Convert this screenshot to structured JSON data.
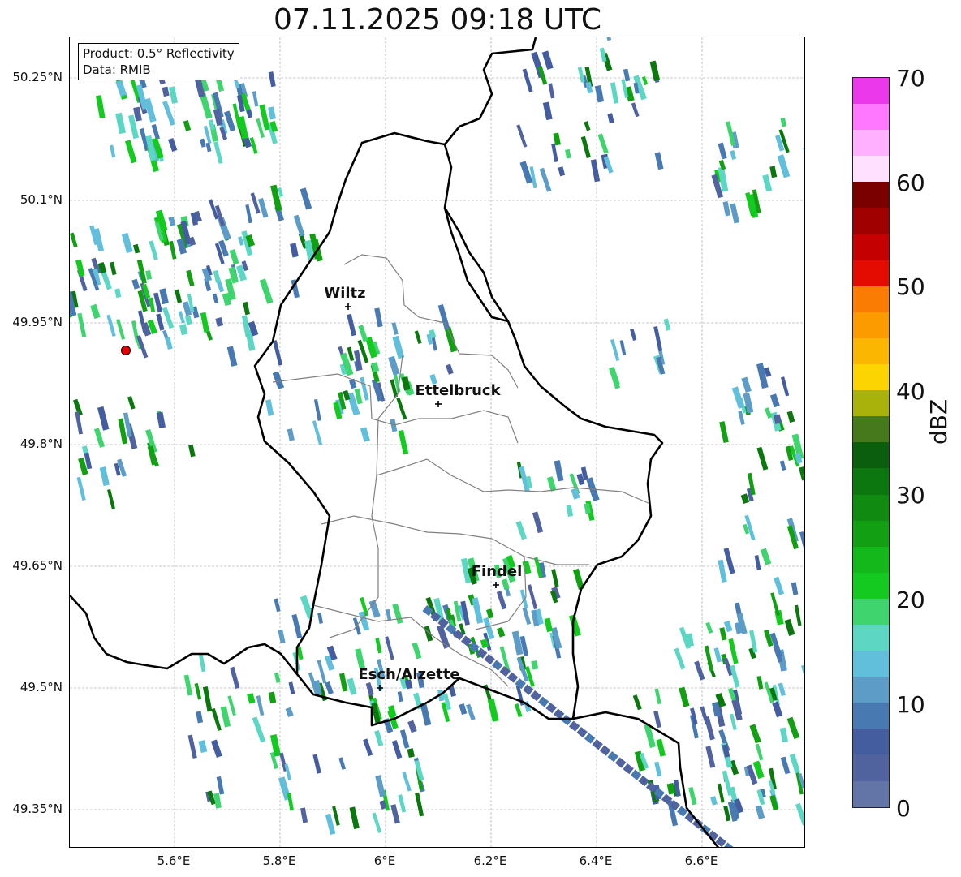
{
  "title": "07.11.2025 09:18 UTC",
  "info": {
    "product": "Product: 0.5° Reflectivity",
    "data_source": "Data: RMIB"
  },
  "axes": {
    "y_ticks": [
      "50.25°N",
      "50.1°N",
      "49.95°N",
      "49.8°N",
      "49.65°N",
      "49.5°N",
      "49.35°N"
    ],
    "x_ticks": [
      "5.6°E",
      "5.8°E",
      "6°E",
      "6.2°E",
      "6.4°E",
      "6.6°E"
    ]
  },
  "cities": [
    {
      "name": "Wiltz"
    },
    {
      "name": "Ettelbruck"
    },
    {
      "name": "Findel"
    },
    {
      "name": "Esch/Alzette"
    }
  ],
  "colorbar": {
    "label": "dBZ",
    "ticks": [
      "0",
      "10",
      "20",
      "30",
      "40",
      "50",
      "60",
      "70"
    ],
    "colors": [
      "#6374a7",
      "#51639e",
      "#435d9f",
      "#4879b1",
      "#5c9cc7",
      "#62bfdb",
      "#5dd7c4",
      "#3fd46e",
      "#14c920",
      "#14b81a",
      "#129f13",
      "#118a11",
      "#0c770f",
      "#0a5e0e",
      "#46791c",
      "#a9b20a",
      "#fcd402",
      "#fbb602",
      "#fb9b00",
      "#fb7c03",
      "#e40c00",
      "#c40000",
      "#a00000",
      "#7a0000",
      "#ffe1ff",
      "#ffb0ff",
      "#ff78ff",
      "#ea38ea"
    ]
  },
  "colors": {
    "border_country": "#000000",
    "border_canton": "#808080",
    "radar_site": "#e60000"
  },
  "icons": {
    "radar_site": "radar-site-marker-icon",
    "city": "city-cross-icon"
  }
}
